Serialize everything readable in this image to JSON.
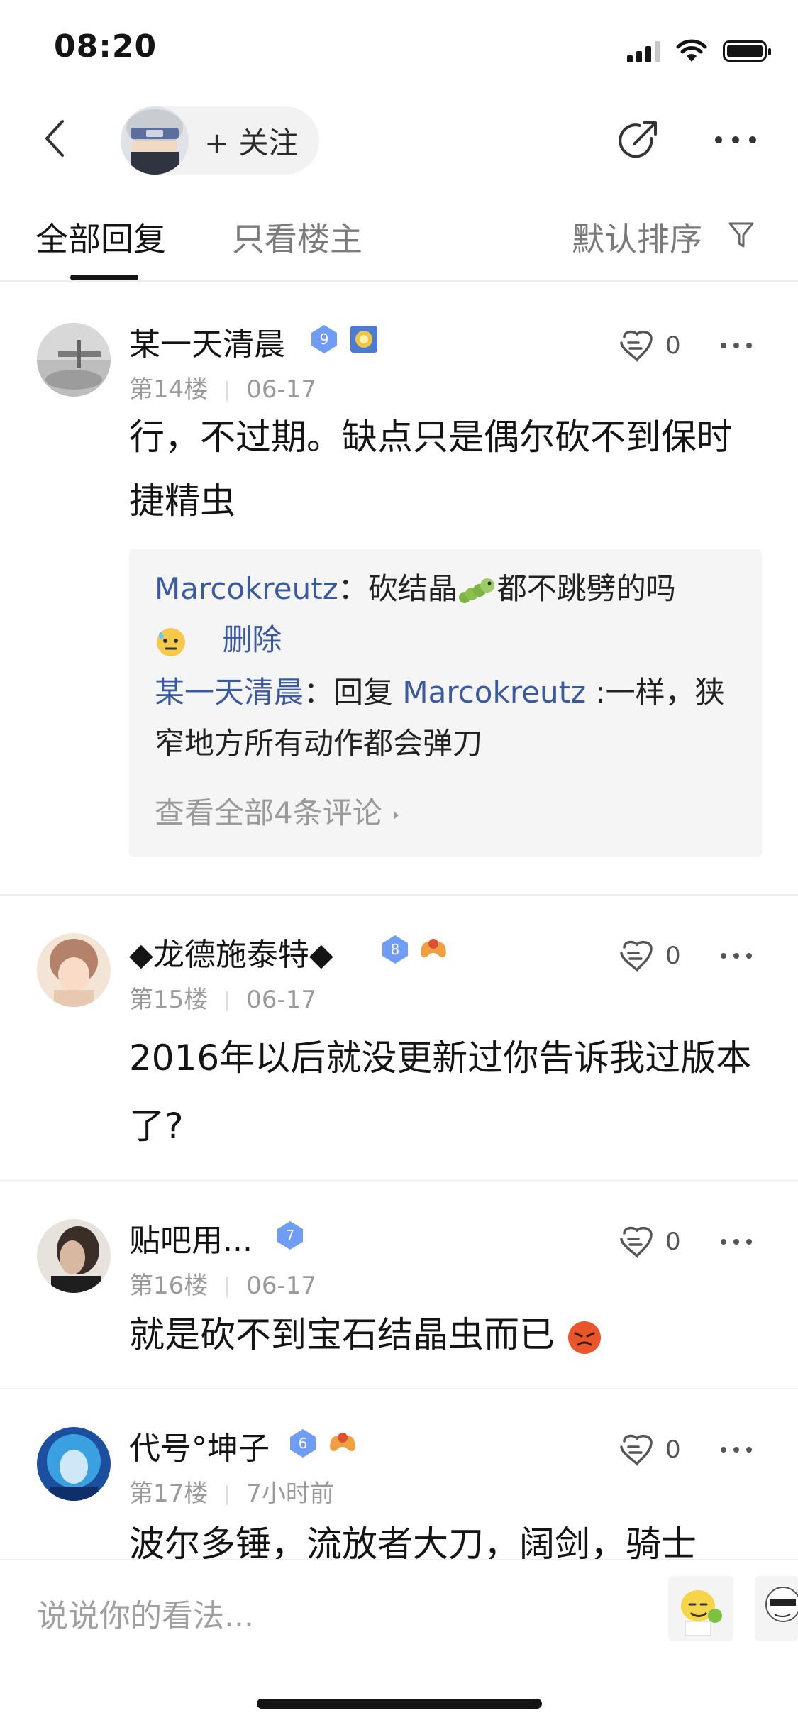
{
  "status": {
    "time": "08:20"
  },
  "nav": {
    "follow_label": "+ 关注"
  },
  "tabs": {
    "all": "全部回复",
    "owner": "只看楼主",
    "sort": "默认排序"
  },
  "posts": [
    {
      "username": "某一天清晨",
      "level": "9",
      "floor": "第14楼",
      "date": "06-17",
      "likes": "0",
      "content": "行，不过期。缺点只是偶尔砍不到保时捷精虫",
      "replies": [
        {
          "name": "Marcokreutz",
          "sep": "：",
          "text": "砍结晶",
          "text2": "都不跳劈的吗",
          "delete": "删除"
        },
        {
          "name": "某一天清晨",
          "sep": "：",
          "text": "回复 ",
          "target": "Marcokreutz",
          "text2": " :一样，狭窄地方所有动作都会弹刀"
        }
      ],
      "view_all": "查看全部4条评论"
    },
    {
      "username": "◆龙德施泰特◆",
      "level": "8",
      "floor": "第15楼",
      "date": "06-17",
      "likes": "0",
      "content": "2016年以后就没更新过你告诉我过版本了?"
    },
    {
      "username": "贴吧用...",
      "level": "7",
      "floor": "第16楼",
      "date": "06-17",
      "likes": "0",
      "content": "就是砍不到宝石结晶虫而已"
    },
    {
      "username": "代号°坤子",
      "level": "6",
      "floor": "第17楼",
      "date": "7小时前",
      "likes": "0",
      "content": "波尔多锤，流放者大刀，阔剑，骑士"
    }
  ],
  "bottom": {
    "placeholder": "说说你的看法..."
  },
  "colors": {
    "link": "#3a5aa0",
    "level_badge": "#6f9cf5"
  }
}
